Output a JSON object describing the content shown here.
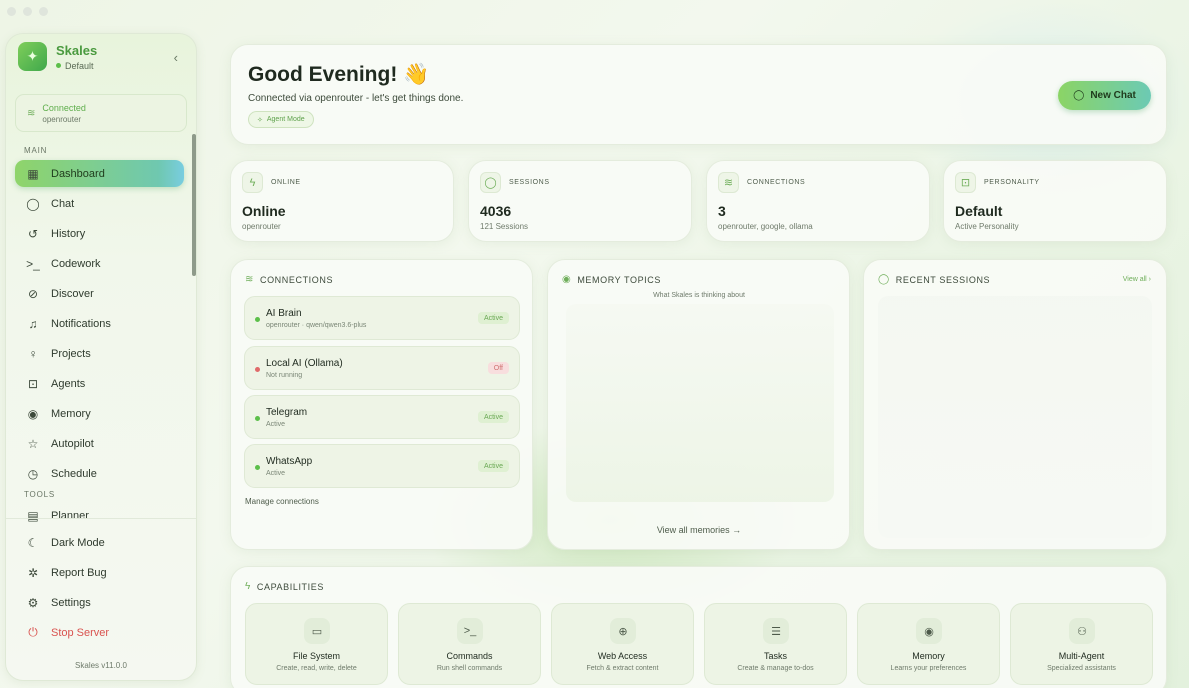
{
  "app": {
    "name": "Skales",
    "profile": "Default",
    "version": "Skales v11.0.0"
  },
  "sidebar": {
    "connection": {
      "status": "Connected",
      "provider": "openrouter"
    },
    "main_label": "MAIN",
    "tools_label": "TOOLS",
    "items": [
      {
        "label": "Dashboard",
        "icon": "dashboard-icon"
      },
      {
        "label": "Chat",
        "icon": "chat-icon"
      },
      {
        "label": "History",
        "icon": "history-icon"
      },
      {
        "label": "Codework",
        "icon": "terminal-icon"
      },
      {
        "label": "Discover",
        "icon": "compass-icon"
      },
      {
        "label": "Notifications",
        "icon": "bell-icon"
      },
      {
        "label": "Projects",
        "icon": "lightbulb-icon"
      },
      {
        "label": "Agents",
        "icon": "robot-icon"
      },
      {
        "label": "Memory",
        "icon": "brain-icon"
      },
      {
        "label": "Autopilot",
        "icon": "star-icon"
      },
      {
        "label": "Schedule",
        "icon": "clock-icon"
      }
    ],
    "tools": [
      {
        "label": "Planner",
        "icon": "calendar-icon"
      }
    ],
    "footer": [
      {
        "label": "Dark Mode",
        "icon": "moon-icon"
      },
      {
        "label": "Report Bug",
        "icon": "bug-icon"
      },
      {
        "label": "Settings",
        "icon": "gear-icon"
      },
      {
        "label": "Stop Server",
        "icon": "power-icon"
      }
    ]
  },
  "hero": {
    "greeting": "Good Evening! 👋",
    "subtitle": "Connected via openrouter - let's get things done.",
    "mode": "Agent Mode",
    "new_chat": "New Chat"
  },
  "stats": [
    {
      "label": "ONLINE",
      "value": "Online",
      "sub": "openrouter",
      "icon": "bolt-icon"
    },
    {
      "label": "SESSIONS",
      "value": "4036",
      "sub": "121 Sessions",
      "icon": "chat-bubble-icon"
    },
    {
      "label": "CONNECTIONS",
      "value": "3",
      "sub": "openrouter, google, ollama",
      "icon": "wifi-icon"
    },
    {
      "label": "PERSONALITY",
      "value": "Default",
      "sub": "Active Personality",
      "icon": "robot-icon"
    }
  ],
  "connections": {
    "title": "CONNECTIONS",
    "items": [
      {
        "name": "AI Brain",
        "detail": "openrouter · qwen/qwen3.6-plus",
        "status": "Active",
        "color": "#5cbf4a"
      },
      {
        "name": "Local AI (Ollama)",
        "detail": "Not running",
        "status": "Off",
        "color": "#e06a6a"
      },
      {
        "name": "Telegram",
        "detail": "Active",
        "status": "Active",
        "color": "#5cbf4a"
      },
      {
        "name": "WhatsApp",
        "detail": "Active",
        "status": "Active",
        "color": "#5cbf4a"
      }
    ],
    "manage": "Manage connections"
  },
  "memory": {
    "title": "MEMORY TOPICS",
    "subtitle": "What Skales is thinking about",
    "link": "View all memories →"
  },
  "recent": {
    "title": "RECENT SESSIONS",
    "view_all": "View all ›"
  },
  "capabilities": {
    "title": "CAPABILITIES",
    "items": [
      {
        "name": "File System",
        "desc": "Create, read, write, delete",
        "icon": "folder-icon"
      },
      {
        "name": "Commands",
        "desc": "Run shell commands",
        "icon": "terminal-icon"
      },
      {
        "name": "Web Access",
        "desc": "Fetch & extract content",
        "icon": "globe-icon"
      },
      {
        "name": "Tasks",
        "desc": "Create & manage to-dos",
        "icon": "checklist-icon"
      },
      {
        "name": "Memory",
        "desc": "Learns your preferences",
        "icon": "brain-icon"
      },
      {
        "name": "Multi-Agent",
        "desc": "Specialized assistants",
        "icon": "users-icon"
      }
    ]
  }
}
